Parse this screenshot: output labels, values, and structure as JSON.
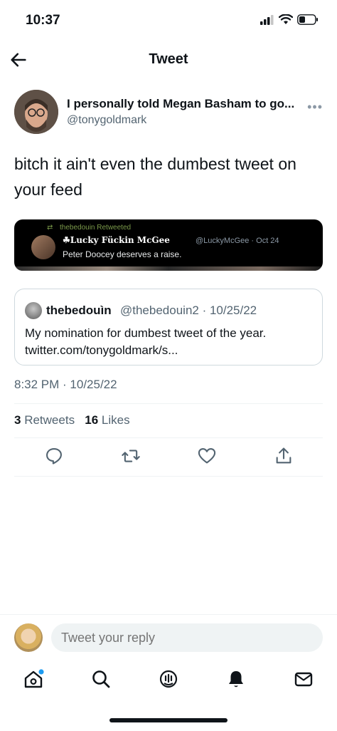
{
  "status_bar": {
    "time": "10:37"
  },
  "header": {
    "title": "Tweet"
  },
  "tweet": {
    "author_name": "I personally told Megan Basham to go...",
    "author_handle": "@tonygoldmark",
    "text": "bitch it ain't even the dumbest tweet on your feed",
    "media": {
      "retweet_line": "thebedouin Retweeted",
      "name": "☘Lucky Fückin McGee",
      "meta": "@LuckyMcGee · Oct 24",
      "text": "Peter Doocey deserves a raise."
    },
    "quote": {
      "name": "thebedouìn",
      "meta": "@thebedouin2 · 10/25/22",
      "text": "My nomination for dumbest tweet of the year. twitter.com/tonygoldmark/s..."
    },
    "timestamp": "8:32 PM · 10/25/22",
    "stats": {
      "retweets_count": "3",
      "retweets_label": "Retweets",
      "likes_count": "16",
      "likes_label": "Likes"
    }
  },
  "reply": {
    "placeholder": "Tweet your reply"
  },
  "colors": {
    "accent": "#1d9bf0",
    "text": "#0f1419",
    "secondary": "#536471"
  }
}
